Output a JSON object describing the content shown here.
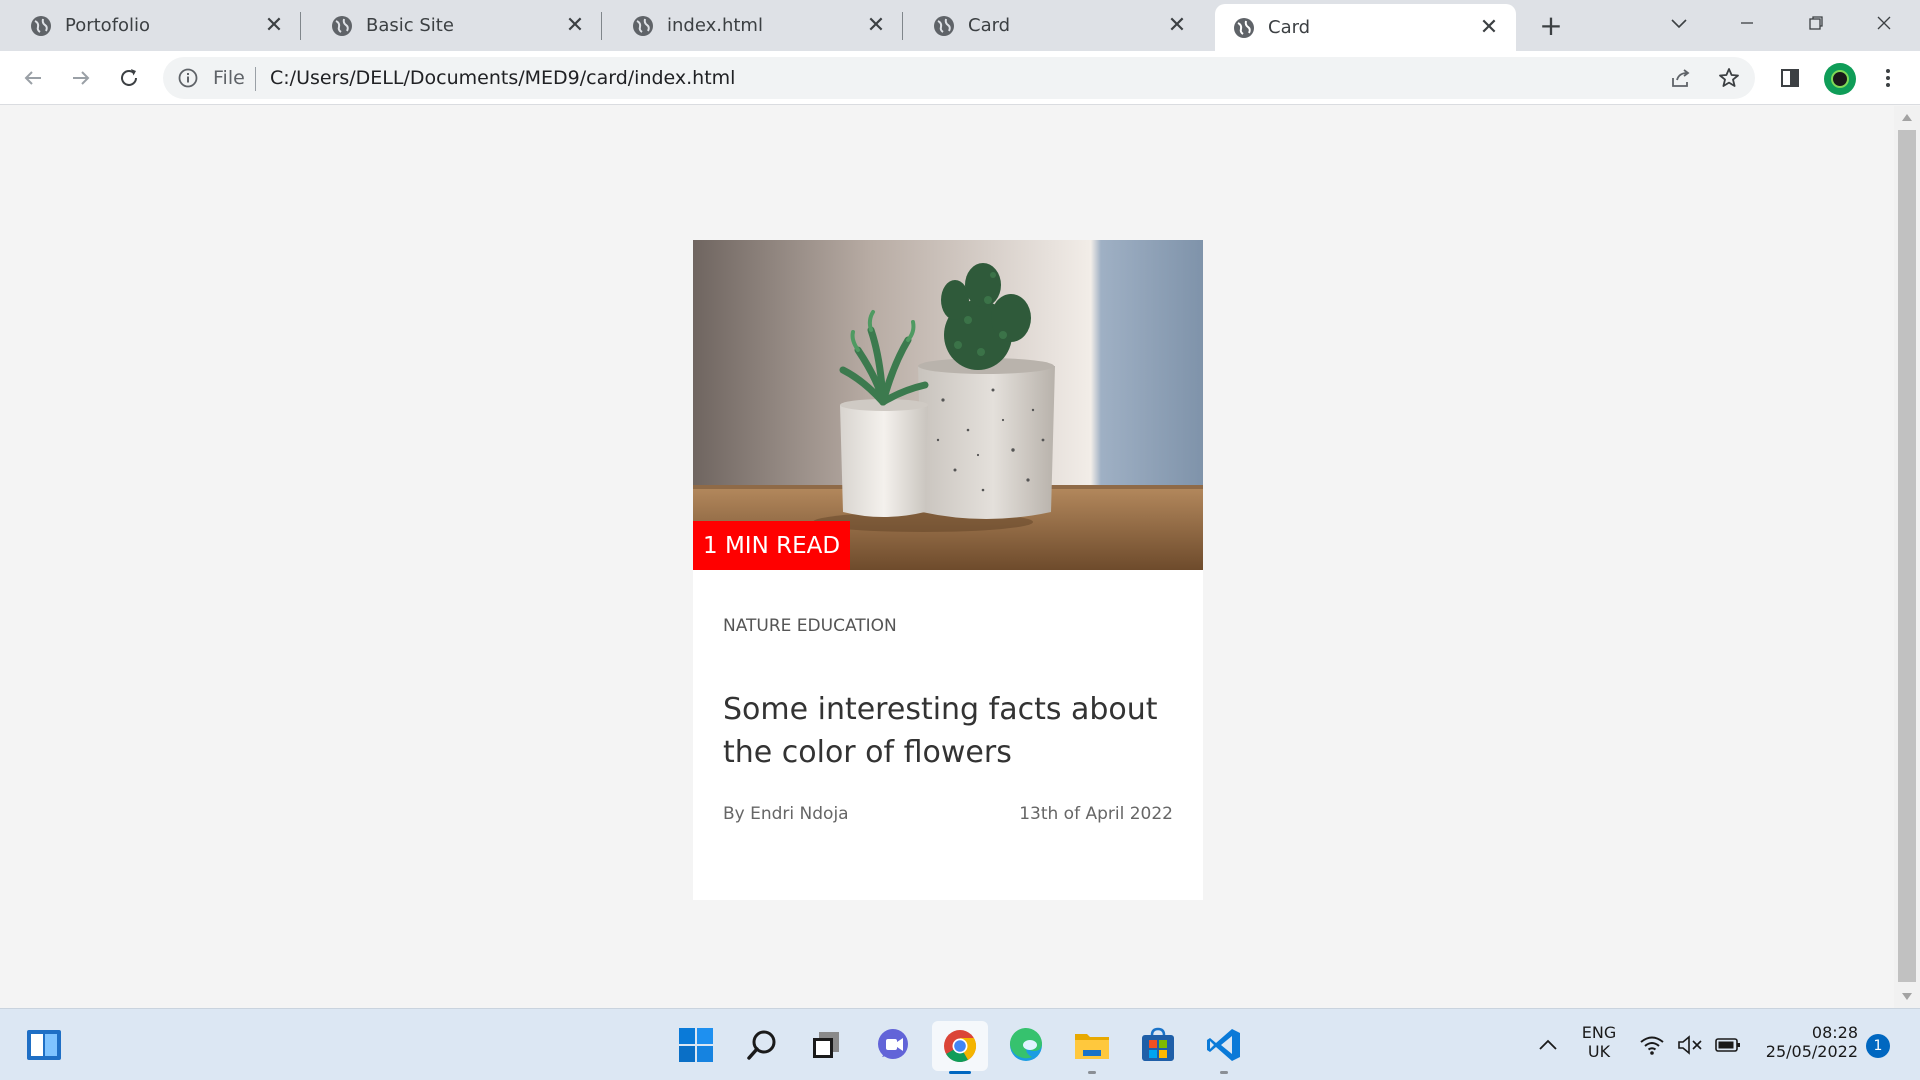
{
  "browser": {
    "tabs": [
      {
        "title": "Portofolio",
        "active": false
      },
      {
        "title": "Basic Site",
        "active": false
      },
      {
        "title": "index.html",
        "active": false
      },
      {
        "title": "Card",
        "active": false
      },
      {
        "title": "Card",
        "active": true
      }
    ],
    "new_tab_label": "+",
    "close_glyph": "✕",
    "address_bar": {
      "scheme_label": "File",
      "url": "C:/Users/DELL/Documents/MED9/card/index.html"
    }
  },
  "card": {
    "badge": "1 MIN READ",
    "category": "NATURE EDUCATION",
    "title": "Some interesting facts about the color of flowers",
    "author": "By Endri Ndoja",
    "date": "13th of April 2022",
    "image_subject": "two-potted-cacti-on-wooden-table",
    "colors": {
      "badge_bg": "#ff0000",
      "badge_text": "#ffffff",
      "card_bg": "#ffffff",
      "page_bg": "#f4f4f4"
    }
  },
  "taskbar": {
    "apps": [
      "widgets-icon",
      "start-icon",
      "search-icon",
      "task-view-icon",
      "teams-chat-icon",
      "chrome-icon",
      "edge-icon",
      "file-explorer-icon",
      "microsoft-store-icon",
      "vscode-icon"
    ],
    "tray": {
      "language_line1": "ENG",
      "language_line2": "UK",
      "time": "08:28",
      "date": "25/05/2022",
      "notification_count": "1"
    }
  }
}
